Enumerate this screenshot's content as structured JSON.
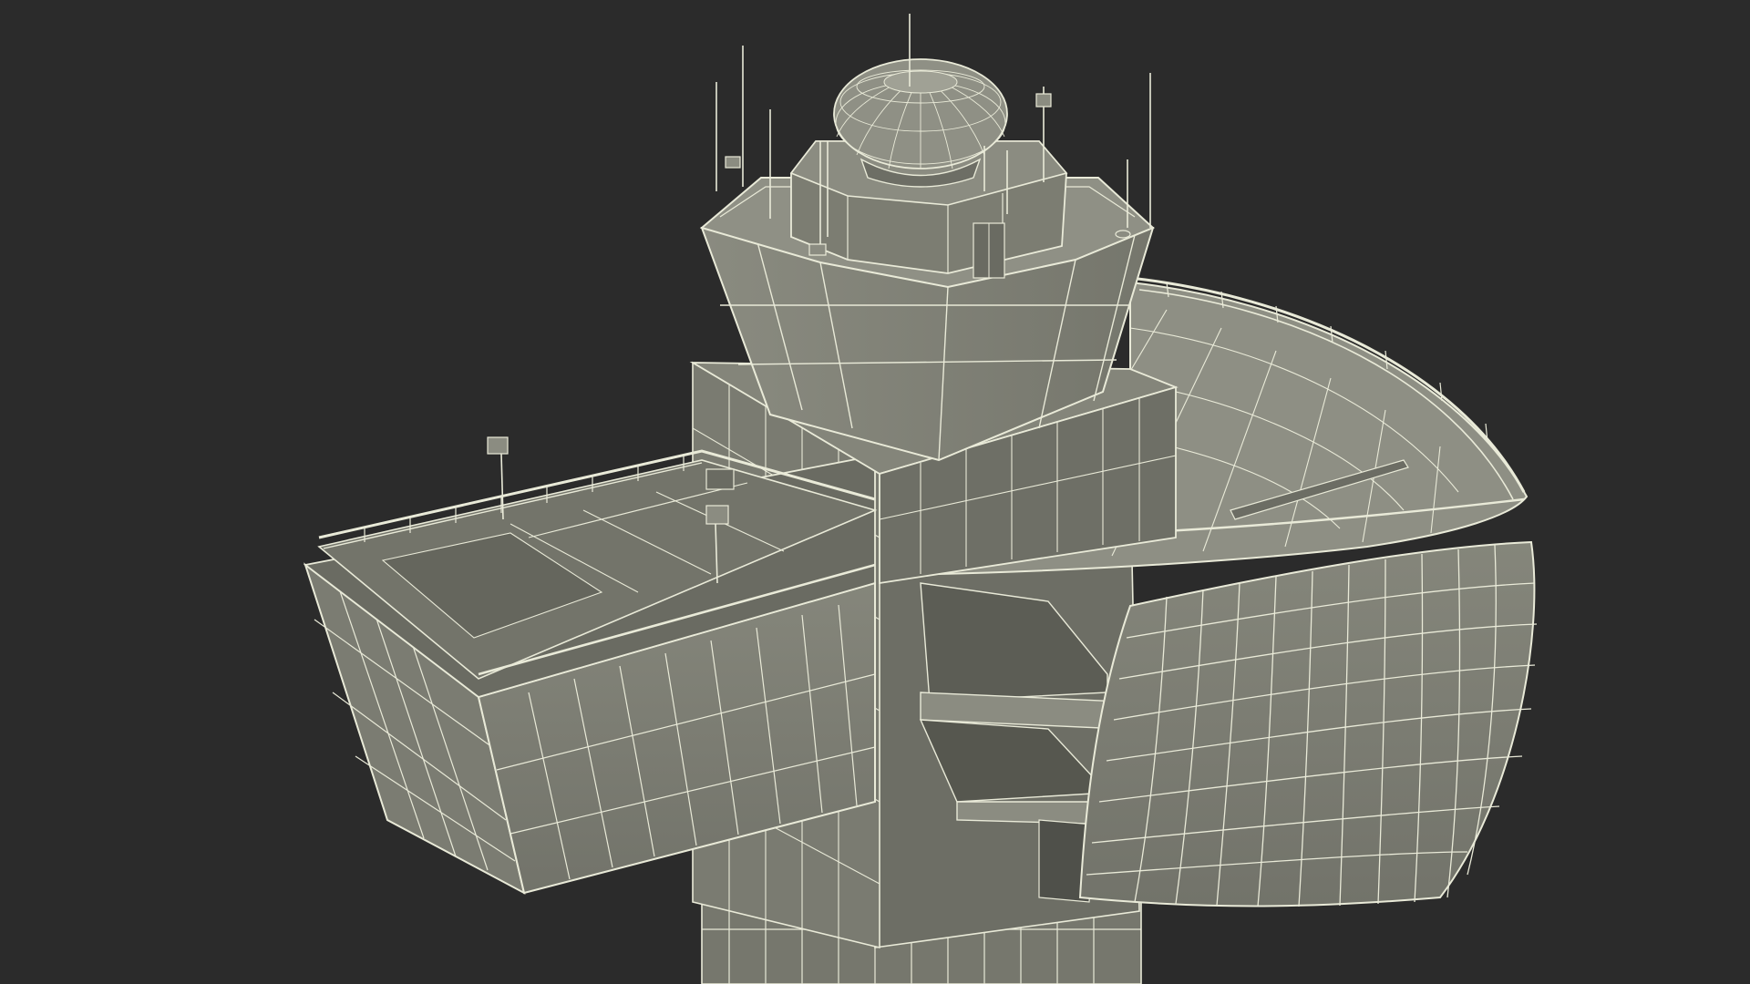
{
  "scene": {
    "subject": "air-traffic-control-tower-wireframe",
    "render_mode": "wireframe-on-shaded",
    "colors": {
      "background": "#2b2b2b",
      "surface": "#7c7d72",
      "surface_light": "#8a8b80",
      "surface_dark": "#63645b",
      "shadow": "#4f504a",
      "wire": "#e9ead8"
    }
  }
}
